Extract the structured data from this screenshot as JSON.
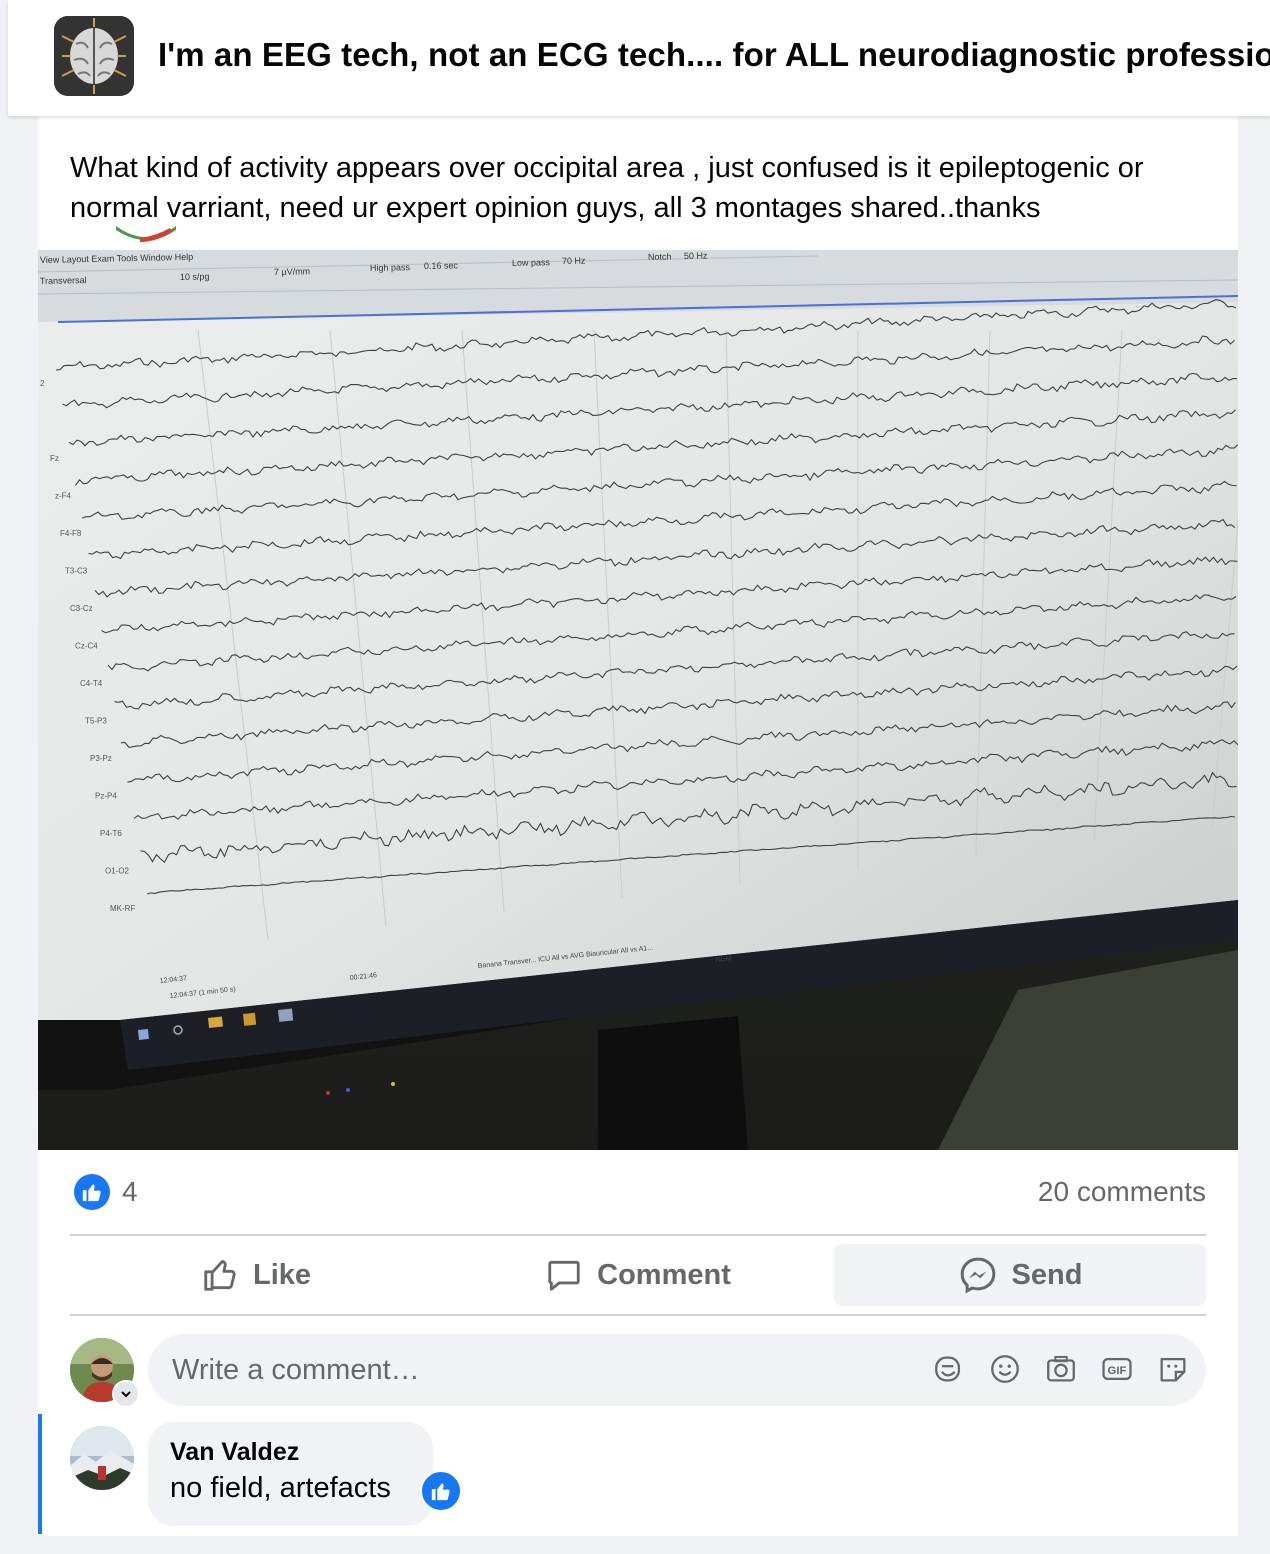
{
  "group": {
    "title": "I'm an EEG tech, not an ECG tech.... for ALL neurodiagnostic professionals"
  },
  "post": {
    "text": "What kind of activity appears over occipital area , just confused is it epileptogenic or normal varriant, need ur expert opinion guys, all 3 montages shared..thanks",
    "image": {
      "menu": [
        "View",
        "Layout",
        "Exam",
        "Tools",
        "Window",
        "Help"
      ],
      "montage": "Transversal",
      "speed": "10 s/pg",
      "sensitivity": "7 µV/mm",
      "high_pass_label": "High pass",
      "high_pass_value": "0.16 sec",
      "low_pass_label": "Low pass",
      "low_pass_value": "70 Hz",
      "notch_label": "Notch",
      "notch_value": "50 Hz",
      "channels": [
        "2",
        "",
        "Fz",
        "z-F4",
        "F4-F8",
        "T3-C3",
        "C3-Cz",
        "Cz-C4",
        "C4-T4",
        "T5-P3",
        "P3-Pz",
        "Pz-P4",
        "P4-T6",
        "O1-O2",
        "MK-RF"
      ],
      "time_start": "12:04:37",
      "time_position": "12:04:37 (1 min 50 s)",
      "elapsed": "00:21:46",
      "montage_tabs": [
        "Banana",
        "Transver...",
        "ICU",
        "All vs AVG",
        "Biauricular",
        "All vs A1..."
      ],
      "status": "NUM"
    }
  },
  "stats": {
    "likes": "4",
    "comments": "20 comments"
  },
  "actions": {
    "like": "Like",
    "comment": "Comment",
    "send": "Send"
  },
  "composer": {
    "placeholder": "Write a comment…"
  },
  "comments": [
    {
      "author": "Van Valdez",
      "text": "no field, artefacts"
    }
  ],
  "colors": {
    "brand_blue": "#1877f2",
    "secondary_text": "#65676b",
    "bubble_bg": "#f0f2f5"
  }
}
